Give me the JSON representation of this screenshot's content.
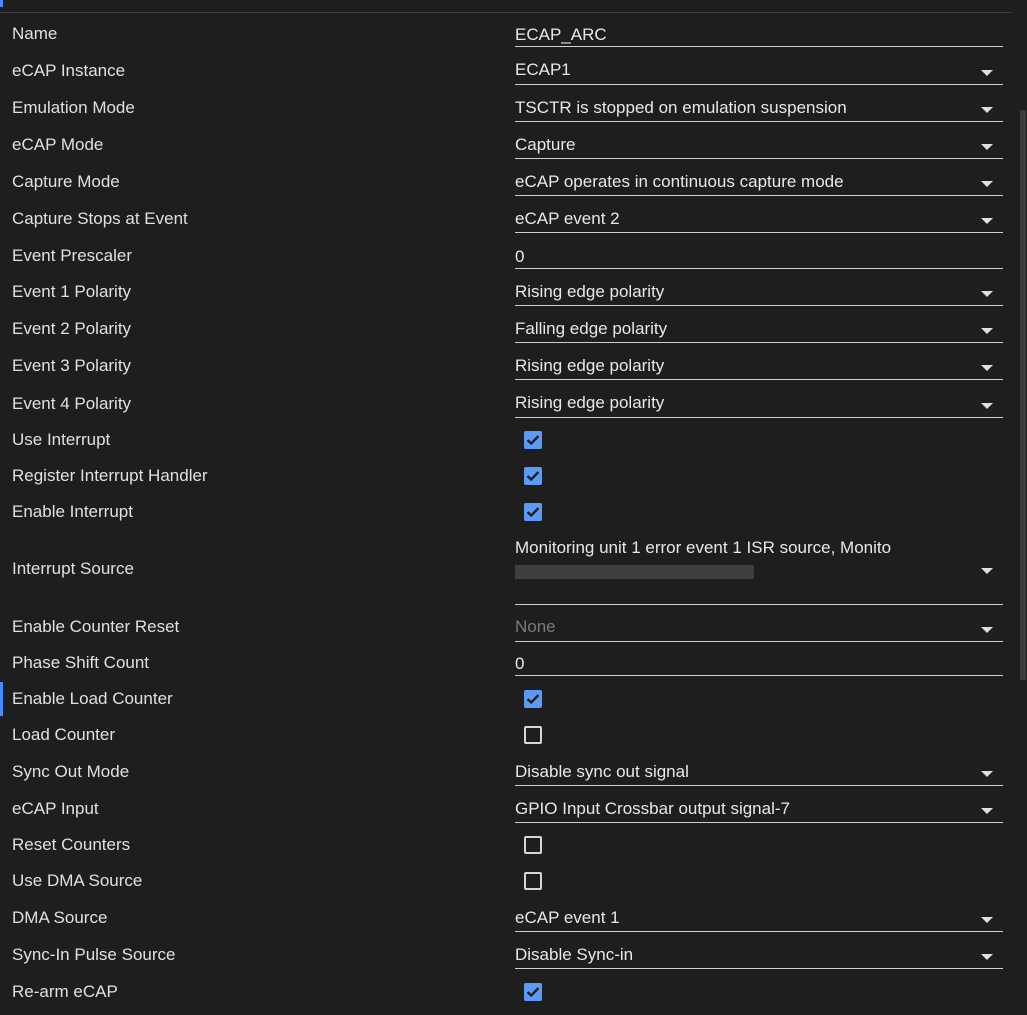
{
  "colors": {
    "background": "#1e1e1e",
    "accent": "#4a8cf7",
    "checkbox": "#5b9bf5"
  },
  "rows": [
    {
      "label": "Name",
      "value": "ECAP_ARC"
    },
    {
      "label": "eCAP Instance",
      "value": "ECAP1"
    },
    {
      "label": "Emulation Mode",
      "value": "TSCTR is stopped on emulation suspension"
    },
    {
      "label": "eCAP Mode",
      "value": "Capture"
    },
    {
      "label": "Capture Mode",
      "value": "eCAP operates in continuous capture mode"
    },
    {
      "label": "Capture Stops at Event",
      "value": "eCAP event 2"
    },
    {
      "label": "Event Prescaler",
      "value": "0"
    },
    {
      "label": "Event 1 Polarity",
      "value": "Rising edge polarity"
    },
    {
      "label": "Event 2 Polarity",
      "value": "Falling edge polarity"
    },
    {
      "label": "Event 3 Polarity",
      "value": "Rising edge polarity"
    },
    {
      "label": "Event 4 Polarity",
      "value": "Rising edge polarity"
    },
    {
      "label": "Use Interrupt",
      "checked": true
    },
    {
      "label": "Register Interrupt Handler",
      "checked": true
    },
    {
      "label": "Enable Interrupt",
      "checked": true
    },
    {
      "label": "Interrupt Source",
      "value": "Monitoring unit 1 error event 1 ISR source, Monito"
    },
    {
      "label": "Enable Counter Reset",
      "value": "None"
    },
    {
      "label": "Phase Shift Count",
      "value": "0"
    },
    {
      "label": "Enable Load Counter",
      "checked": true
    },
    {
      "label": "Load Counter",
      "checked": false
    },
    {
      "label": "Sync Out Mode",
      "value": "Disable sync out signal"
    },
    {
      "label": "eCAP Input",
      "value": "GPIO Input Crossbar output signal-7"
    },
    {
      "label": "Reset Counters",
      "checked": false
    },
    {
      "label": "Use DMA Source",
      "checked": false
    },
    {
      "label": "DMA Source",
      "value": "eCAP event 1"
    },
    {
      "label": "Sync-In Pulse Source",
      "value": "Disable Sync-in"
    },
    {
      "label": "Re-arm eCAP",
      "checked": true
    }
  ]
}
